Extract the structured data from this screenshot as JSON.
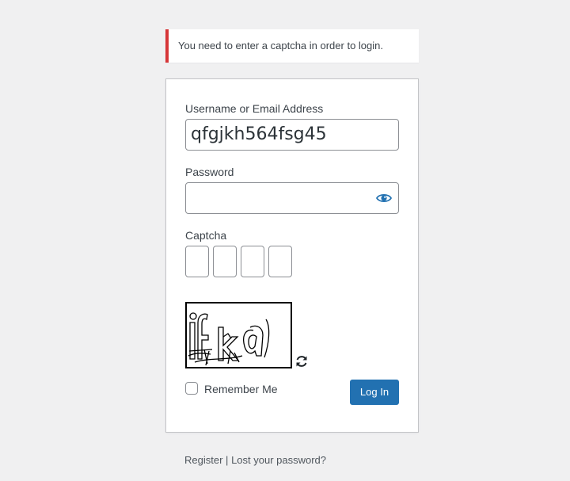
{
  "notice": {
    "message": "You need to enter a captcha in order to login.",
    "accent_color": "#d63638"
  },
  "form": {
    "username_label": "Username or Email Address",
    "username_value": "qfgjkh564fsg45",
    "password_label": "Password",
    "password_value": "",
    "captcha_label": "Captcha",
    "captcha_inputs": [
      "",
      "",
      "",
      ""
    ],
    "captcha_image_text": "ifka",
    "remember_label": "Remember Me",
    "remember_checked": false,
    "login_label": "Log In",
    "login_color": "#2271b1"
  },
  "nav": {
    "register": "Register",
    "separator": "|",
    "lost_password": "Lost your password?"
  },
  "icons": {
    "password_toggle": "eye-icon",
    "captcha_refresh": "refresh-icon"
  }
}
